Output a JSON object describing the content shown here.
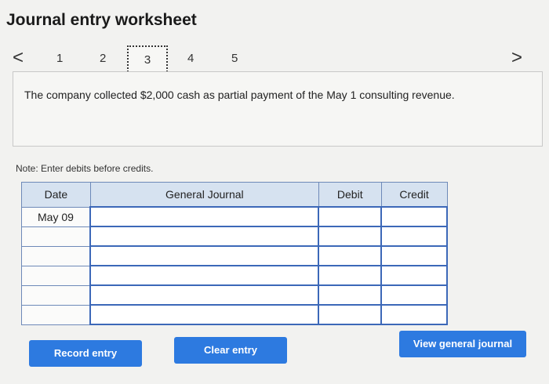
{
  "header": {
    "title": "Journal entry worksheet"
  },
  "nav": {
    "prev": "<",
    "next": ">",
    "steps": [
      "1",
      "2",
      "3",
      "4",
      "5"
    ],
    "active_step": "3"
  },
  "prompt": {
    "text": "The company collected $2,000 cash as partial payment of the May 1 consulting revenue."
  },
  "note": "Note: Enter debits before credits.",
  "table": {
    "headers": {
      "date": "Date",
      "journal": "General Journal",
      "debit": "Debit",
      "credit": "Credit"
    },
    "rows": [
      {
        "date": "May 09",
        "journal": "",
        "debit": "",
        "credit": ""
      },
      {
        "date": "",
        "journal": "",
        "debit": "",
        "credit": ""
      },
      {
        "date": "",
        "journal": "",
        "debit": "",
        "credit": ""
      },
      {
        "date": "",
        "journal": "",
        "debit": "",
        "credit": ""
      },
      {
        "date": "",
        "journal": "",
        "debit": "",
        "credit": ""
      },
      {
        "date": "",
        "journal": "",
        "debit": "",
        "credit": ""
      }
    ]
  },
  "buttons": {
    "record": "Record entry",
    "clear": "Clear entry",
    "view": "View general journal"
  }
}
